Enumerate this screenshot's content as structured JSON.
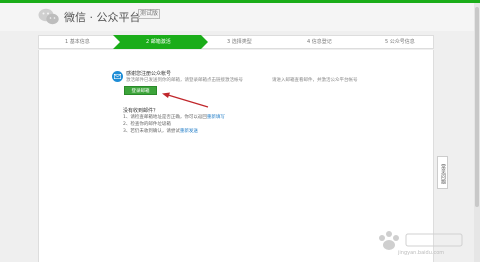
{
  "brand": {
    "title": "微信 · 公众平台",
    "badge": "测试版"
  },
  "steps": [
    {
      "label": "1 基本信息",
      "active": false
    },
    {
      "label": "2 邮箱激活",
      "active": true
    },
    {
      "label": "3 选择类型",
      "active": false
    },
    {
      "label": "4 信息登记",
      "active": false
    },
    {
      "label": "5 公众号信息",
      "active": false
    }
  ],
  "activation": {
    "email": "感谢您注册公众帐号",
    "notice": "激活邮件已发送到你的邮箱，请登录邮箱点击链接激活帐号",
    "side_note": "请进入邮箱查看邮件，并激活公众平台帐号",
    "login_button": "登录邮箱"
  },
  "help": {
    "title": "没有收到邮件？",
    "items": [
      {
        "text": "1、请检查邮箱地址是否正确，你可以返回",
        "link": "重新填写"
      },
      {
        "text": "2、检查你的邮件垃圾箱",
        "link": ""
      },
      {
        "text": "3、若仍未收到确认，请尝试",
        "link": "重新发送"
      }
    ]
  },
  "feedback_tab": "常见问题",
  "watermark": "jingyan.baidu.com",
  "colors": {
    "accent": "#1aad19",
    "button": "#3ca43a",
    "arrow": "#c0262b",
    "link": "#1e7bc7"
  }
}
